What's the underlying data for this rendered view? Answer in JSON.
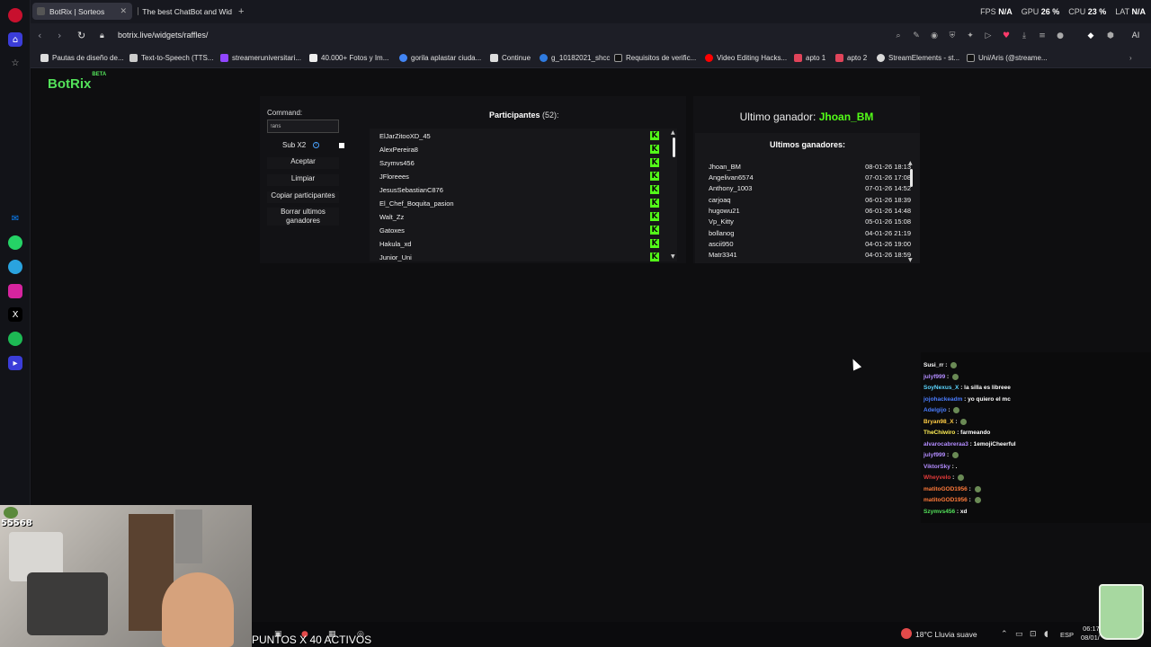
{
  "browser": {
    "tabs": [
      {
        "label": "BotRix | Sorteos",
        "active": true
      },
      {
        "label": "The best ChatBot and Wid",
        "active": false
      }
    ],
    "new_tab_icon": "plus-icon",
    "stats": {
      "fps_label": "FPS",
      "fps_value": "N/A",
      "gpu_label": "GPU",
      "gpu_value": "26 %",
      "cpu_label": "CPU",
      "cpu_value": "23 %",
      "lat_label": "LAT",
      "lat_value": "N/A"
    },
    "url": "botrix.live/widgets/raffles/",
    "ai_label": "AI",
    "bookmarks": [
      "Pautas de diseño de...",
      "Text-to-Speech (TTS...",
      "streameruniversitari...",
      "40.000+ Fotos y Im...",
      "gorila aplastar ciuda...",
      "Continue",
      "g_10182021_shcc",
      "Requisitos de verific...",
      "Video Editing Hacks...",
      "apto 1",
      "apto 2",
      "StreamElements - st...",
      "Uni/Aris (@streame..."
    ]
  },
  "logo": {
    "text": "BotRix",
    "badge": "BETA"
  },
  "raffle": {
    "command_label": "Command:",
    "command_value": "!aris",
    "sub_x2_label": "Sub X2",
    "accept_label": "Aceptar",
    "clear_label": "Limpiar",
    "copy_label": "Copiar participantes",
    "delete_label": "Borrar ultimos ganadores",
    "participants_title": "Participantes",
    "participants_count": "(52):",
    "participants": [
      "ElJarZitooXD_45",
      "AlexPereira8",
      "Szymvs456",
      "JFloreees",
      "JesusSebastianC876",
      "El_Chef_Boquita_pasion",
      "Walt_Zz",
      "Gatoxes",
      "Hakula_xd",
      "Junior_Uni"
    ],
    "platform_icon_letter": "K"
  },
  "winners": {
    "last_winner_label": "Ultimo ganador:",
    "last_winner_name": "Jhoan_BM",
    "title": "Ultimos ganadores:",
    "rows": [
      {
        "name": "Jhoan_BM",
        "date": "08-01-26 18:13"
      },
      {
        "name": "Angelivan6574",
        "date": "07-01-26 17:08"
      },
      {
        "name": "Anthony_1003",
        "date": "07-01-26 14:52"
      },
      {
        "name": "carjoaq",
        "date": "06-01-26 18:39"
      },
      {
        "name": "hugowu21",
        "date": "06-01-26 14:48"
      },
      {
        "name": "Vp_Kitty",
        "date": "05-01-26 15:08"
      },
      {
        "name": "bollanog",
        "date": "04-01-26 21:19"
      },
      {
        "name": "ascii950",
        "date": "04-01-26 19:00"
      },
      {
        "name": "Matr3341",
        "date": "04-01-26 18:59"
      }
    ]
  },
  "chat": [
    {
      "user": "Susi_rr",
      "msg": "",
      "color": "#ffffff"
    },
    {
      "user": "julyf999",
      "msg": "",
      "color": "#b38cff"
    },
    {
      "user": "SoyNexus_X",
      "msg": "la silla es libreee",
      "color": "#5bd6ff"
    },
    {
      "user": "jojohackeadm",
      "msg": "yo quiero el mc",
      "color": "#4a7dff"
    },
    {
      "user": "Adelgijo",
      "msg": "",
      "color": "#4a7dff"
    },
    {
      "user": "Bryan98_X",
      "msg": "",
      "color": "#ffcc44"
    },
    {
      "user": "TheChiwiro",
      "msg": "farmeando",
      "color": "#ffee55"
    },
    {
      "user": "alvarocabreraa3",
      "msg": "1emojiCheerful",
      "color": "#b38cff"
    },
    {
      "user": "julyf999",
      "msg": "",
      "color": "#b38cff"
    },
    {
      "user": "ViktorSky",
      "msg": ".",
      "color": "#b38cff"
    },
    {
      "user": "Wheyvelo",
      "msg": "",
      "color": "#e23a3a"
    },
    {
      "user": "matitoGOD1956",
      "msg": "",
      "color": "#ff7a3a"
    },
    {
      "user": "matitoGOD1956",
      "msg": "",
      "color": "#ff7a3a"
    },
    {
      "user": "Szymvs456",
      "msg": "xd",
      "color": "#53e25a"
    }
  ],
  "stream": {
    "viewer_count": "55568",
    "points_text": "PUNTOS X 40 ACTIVOS"
  },
  "taskbar": {
    "weather": "18°C  Lluvia suave",
    "lang": "ESP",
    "time": "06:17",
    "date": "08/01/"
  },
  "colors": {
    "accent_green": "#53fc18",
    "botrix_green": "#53e25a"
  }
}
